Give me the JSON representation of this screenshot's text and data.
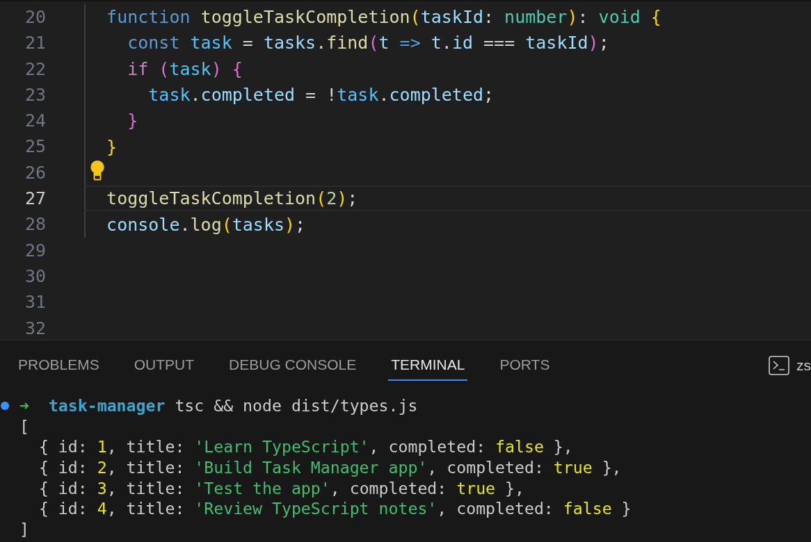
{
  "editor": {
    "lines": [
      {
        "number": "20",
        "current": false,
        "guide": true,
        "tokens": [
          {
            "text": "  function ",
            "kind": "storage"
          },
          {
            "text": "toggleTaskCompletion",
            "kind": "function"
          },
          {
            "text": "(",
            "kind": "bracket1"
          },
          {
            "text": "taskId",
            "kind": "variable"
          },
          {
            "text": ": ",
            "kind": "plain"
          },
          {
            "text": "number",
            "kind": "type"
          },
          {
            "text": ")",
            "kind": "bracket1"
          },
          {
            "text": ": ",
            "kind": "plain"
          },
          {
            "text": "void ",
            "kind": "type"
          },
          {
            "text": "{",
            "kind": "bracket1"
          }
        ]
      },
      {
        "number": "21",
        "current": false,
        "guide": true,
        "tokens": [
          {
            "text": "    const ",
            "kind": "storage"
          },
          {
            "text": "task",
            "kind": "constant"
          },
          {
            "text": " = ",
            "kind": "plain"
          },
          {
            "text": "tasks",
            "kind": "variable"
          },
          {
            "text": ".",
            "kind": "plain"
          },
          {
            "text": "find",
            "kind": "function"
          },
          {
            "text": "(",
            "kind": "bracket2"
          },
          {
            "text": "t ",
            "kind": "variable"
          },
          {
            "text": "=> ",
            "kind": "storage"
          },
          {
            "text": "t",
            "kind": "variable"
          },
          {
            "text": ".",
            "kind": "plain"
          },
          {
            "text": "id",
            "kind": "variable"
          },
          {
            "text": " === ",
            "kind": "plain"
          },
          {
            "text": "taskId",
            "kind": "variable"
          },
          {
            "text": ")",
            "kind": "bracket2"
          },
          {
            "text": ";",
            "kind": "plain"
          }
        ]
      },
      {
        "number": "22",
        "current": false,
        "guide": true,
        "tokens": [
          {
            "text": "    if ",
            "kind": "control"
          },
          {
            "text": "(",
            "kind": "bracket2"
          },
          {
            "text": "task",
            "kind": "constant"
          },
          {
            "text": ") ",
            "kind": "bracket2"
          },
          {
            "text": "{",
            "kind": "bracket2"
          }
        ]
      },
      {
        "number": "23",
        "current": false,
        "guide": true,
        "tokens": [
          {
            "text": "      task",
            "kind": "constant"
          },
          {
            "text": ".",
            "kind": "plain"
          },
          {
            "text": "completed",
            "kind": "variable"
          },
          {
            "text": " = !",
            "kind": "plain"
          },
          {
            "text": "task",
            "kind": "constant"
          },
          {
            "text": ".",
            "kind": "plain"
          },
          {
            "text": "completed",
            "kind": "variable"
          },
          {
            "text": ";",
            "kind": "plain"
          }
        ]
      },
      {
        "number": "24",
        "current": false,
        "guide": true,
        "tokens": [
          {
            "text": "    }",
            "kind": "bracket2"
          }
        ]
      },
      {
        "number": "25",
        "current": false,
        "guide": true,
        "tokens": [
          {
            "text": "  }",
            "kind": "bracket1"
          }
        ]
      },
      {
        "number": "26",
        "current": false,
        "guide": true,
        "lightbulb": true
      },
      {
        "number": "27",
        "current": true,
        "guide": true,
        "tokens": [
          {
            "text": "  toggleTaskCompletion",
            "kind": "function"
          },
          {
            "text": "(",
            "kind": "bracket1"
          },
          {
            "text": "2",
            "kind": "number"
          },
          {
            "text": ")",
            "kind": "bracket1"
          },
          {
            "text": ";",
            "kind": "plain"
          }
        ]
      },
      {
        "number": "28",
        "current": false,
        "guide": true,
        "tokens": [
          {
            "text": "  console",
            "kind": "variable"
          },
          {
            "text": ".",
            "kind": "plain"
          },
          {
            "text": "log",
            "kind": "function"
          },
          {
            "text": "(",
            "kind": "bracket1"
          },
          {
            "text": "tasks",
            "kind": "variable"
          },
          {
            "text": ")",
            "kind": "bracket1"
          },
          {
            "text": ";",
            "kind": "plain"
          }
        ]
      },
      {
        "number": "29",
        "current": false,
        "guide": false
      },
      {
        "number": "30",
        "current": false,
        "guide": false
      },
      {
        "number": "31",
        "current": false,
        "guide": false
      },
      {
        "number": "32",
        "current": false,
        "guide": false
      }
    ]
  },
  "panel": {
    "tabs": [
      {
        "label": "PROBLEMS",
        "selected": false
      },
      {
        "label": "OUTPUT",
        "selected": false
      },
      {
        "label": "DEBUG CONSOLE",
        "selected": false
      },
      {
        "label": "TERMINAL",
        "selected": true
      },
      {
        "label": "PORTS",
        "selected": false
      }
    ],
    "shell_label": "zs",
    "terminal": [
      {
        "status_dot": true,
        "tokens": [
          {
            "text": "➜  ",
            "kind": "arrow"
          },
          {
            "text": "task-manager",
            "kind": "dir"
          },
          {
            "text": " tsc && node dist/types.js",
            "kind": "plain"
          }
        ]
      },
      {
        "status_dot": false,
        "tokens": [
          {
            "text": "[",
            "kind": "plain"
          }
        ]
      },
      {
        "status_dot": false,
        "tokens": [
          {
            "text": "  { id: ",
            "kind": "plain"
          },
          {
            "text": "1",
            "kind": "number"
          },
          {
            "text": ", title: ",
            "kind": "plain"
          },
          {
            "text": "'Learn TypeScript'",
            "kind": "string"
          },
          {
            "text": ", completed: ",
            "kind": "plain"
          },
          {
            "text": "false",
            "kind": "boolean"
          },
          {
            "text": " },",
            "kind": "plain"
          }
        ]
      },
      {
        "status_dot": false,
        "tokens": [
          {
            "text": "  { id: ",
            "kind": "plain"
          },
          {
            "text": "2",
            "kind": "number"
          },
          {
            "text": ", title: ",
            "kind": "plain"
          },
          {
            "text": "'Build Task Manager app'",
            "kind": "string"
          },
          {
            "text": ", completed: ",
            "kind": "plain"
          },
          {
            "text": "true",
            "kind": "boolean"
          },
          {
            "text": " },",
            "kind": "plain"
          }
        ]
      },
      {
        "status_dot": false,
        "tokens": [
          {
            "text": "  { id: ",
            "kind": "plain"
          },
          {
            "text": "3",
            "kind": "number"
          },
          {
            "text": ", title: ",
            "kind": "plain"
          },
          {
            "text": "'Test the app'",
            "kind": "string"
          },
          {
            "text": ", completed: ",
            "kind": "plain"
          },
          {
            "text": "true",
            "kind": "boolean"
          },
          {
            "text": " },",
            "kind": "plain"
          }
        ]
      },
      {
        "status_dot": false,
        "tokens": [
          {
            "text": "  { id: ",
            "kind": "plain"
          },
          {
            "text": "4",
            "kind": "number"
          },
          {
            "text": ", title: ",
            "kind": "plain"
          },
          {
            "text": "'Review TypeScript notes'",
            "kind": "string"
          },
          {
            "text": ", completed: ",
            "kind": "plain"
          },
          {
            "text": "false",
            "kind": "boolean"
          },
          {
            "text": " }",
            "kind": "plain"
          }
        ]
      },
      {
        "status_dot": false,
        "tokens": [
          {
            "text": "]",
            "kind": "plain"
          }
        ]
      }
    ]
  }
}
